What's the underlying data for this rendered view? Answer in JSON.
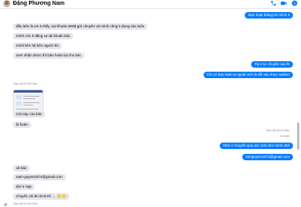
{
  "header": {
    "contact_name": "Đặng Phương Nam",
    "phone_icon": "phone-icon",
    "video_icon": "video-icon",
    "info_icon": "info-icon"
  },
  "messages": {
    "out_1": "Bạn hoạt thông tin mình á",
    "in_1": "đầu bên là em k thấy, sai khoản 600$ gửi chuyển và mình cũng k đụng vào luôn",
    "in_2": "mình còn k đăng xe tài khoản bác",
    "in_3": "mình liên hệ bên người bù",
    "in_4": "xem nhận được thì báo hoàn lại cho bác",
    "out_2": "Rp k tự chuyển sai đc",
    "out_3": "Chỉ có bạn loak ra ngoài mới là đổi sáu thực authen",
    "shared_caption": "Bạn đã bỏ thẻ bạn",
    "in_5": "Cái này của bác",
    "in_6": "là hoàn",
    "time_stamp": "Bạn đã trả lời Bạn",
    "time_stamp_2": "là hoàn",
    "out_4": "Okie e chuyển qua acc mới cho mình nhé",
    "out_5": "tienguyen1674@gmail.com",
    "in_7": "ok bác",
    "in_8": "nam-guyen1674@gmail.com",
    "in_9": "đợi e nạp",
    "in_10": "chuyển cái ăn limit thì ... ",
    "footer_meta": "Bạn đã bỏ thẻ Bạn"
  },
  "colors": {
    "accent": "#0a7cff",
    "incoming_bubble": "#e4e6eb",
    "meta_text": "#8a8d91"
  }
}
